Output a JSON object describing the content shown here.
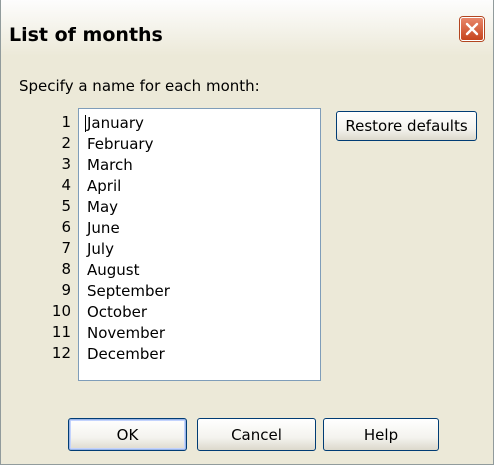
{
  "window": {
    "title": "List of months"
  },
  "prompt": "Specify a name for each month:",
  "numbers": [
    "1",
    "2",
    "3",
    "4",
    "5",
    "6",
    "7",
    "8",
    "9",
    "10",
    "11",
    "12"
  ],
  "months": [
    "January",
    "February",
    "March",
    "April",
    "May",
    "June",
    "July",
    "August",
    "September",
    "October",
    "November",
    "December"
  ],
  "buttons": {
    "restore": "Restore defaults",
    "ok": "OK",
    "cancel": "Cancel",
    "help": "Help"
  },
  "colors": {
    "dialog_bg": "#ece9d8",
    "close_button": "#c6451e",
    "button_border": "#003c74"
  }
}
